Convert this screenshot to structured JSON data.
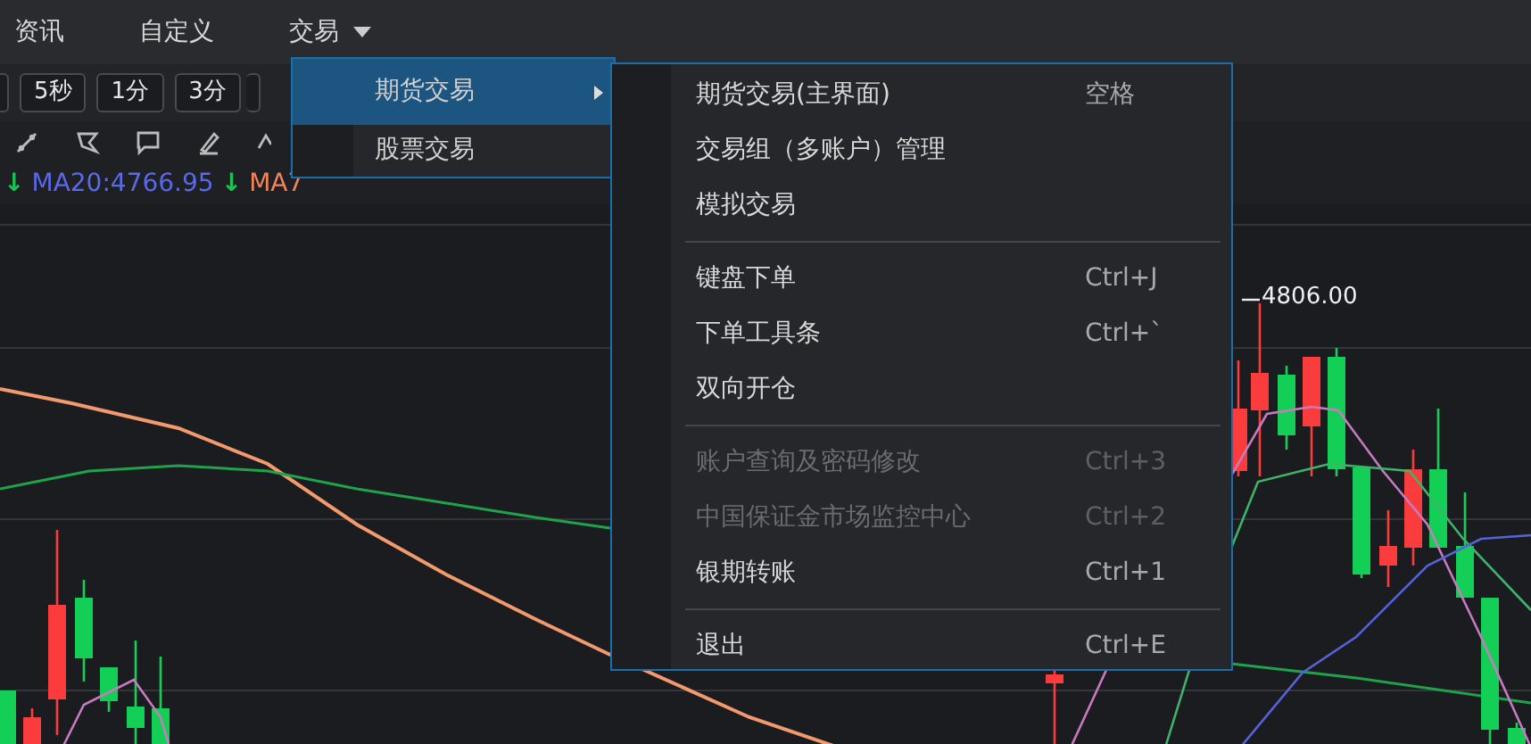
{
  "menubar": [
    {
      "label": "资讯",
      "dropdown": false
    },
    {
      "label": "自定义",
      "dropdown": false
    },
    {
      "label": "交易",
      "dropdown": true
    }
  ],
  "period_buttons": [
    "5秒",
    "1分",
    "3分"
  ],
  "legend": [
    {
      "arrow": "↓",
      "text": "MA20:4766.95",
      "color": "#5a6ae6"
    },
    {
      "arrow": "↓",
      "text": "MA7",
      "color": "#f0835c"
    }
  ],
  "chart": {
    "max_label": "4806.00"
  },
  "menu": [
    {
      "label": "期货交易",
      "selected": true,
      "submenu": true
    },
    {
      "label": "股票交易",
      "selected": false,
      "submenu": false
    }
  ],
  "submenu": [
    [
      {
        "label": "期货交易(主界面)",
        "shortcut": "空格",
        "disabled": false
      },
      {
        "label": "交易组（多账户）管理",
        "disabled": false
      },
      {
        "label": "模拟交易",
        "disabled": false
      }
    ],
    [
      {
        "label": "键盘下单",
        "shortcut": "Ctrl+J",
        "disabled": false
      },
      {
        "label": "下单工具条",
        "shortcut": "Ctrl+`",
        "disabled": false
      },
      {
        "label": "双向开仓",
        "disabled": false
      }
    ],
    [
      {
        "label": "账户查询及密码修改",
        "shortcut": "Ctrl+3",
        "disabled": true
      },
      {
        "label": "中国保证金市场监控中心",
        "shortcut": "Ctrl+2",
        "disabled": true
      },
      {
        "label": "银期转账",
        "shortcut": "Ctrl+1",
        "disabled": false
      }
    ],
    [
      {
        "label": "退出",
        "shortcut": "Ctrl+E",
        "disabled": false
      }
    ]
  ]
}
